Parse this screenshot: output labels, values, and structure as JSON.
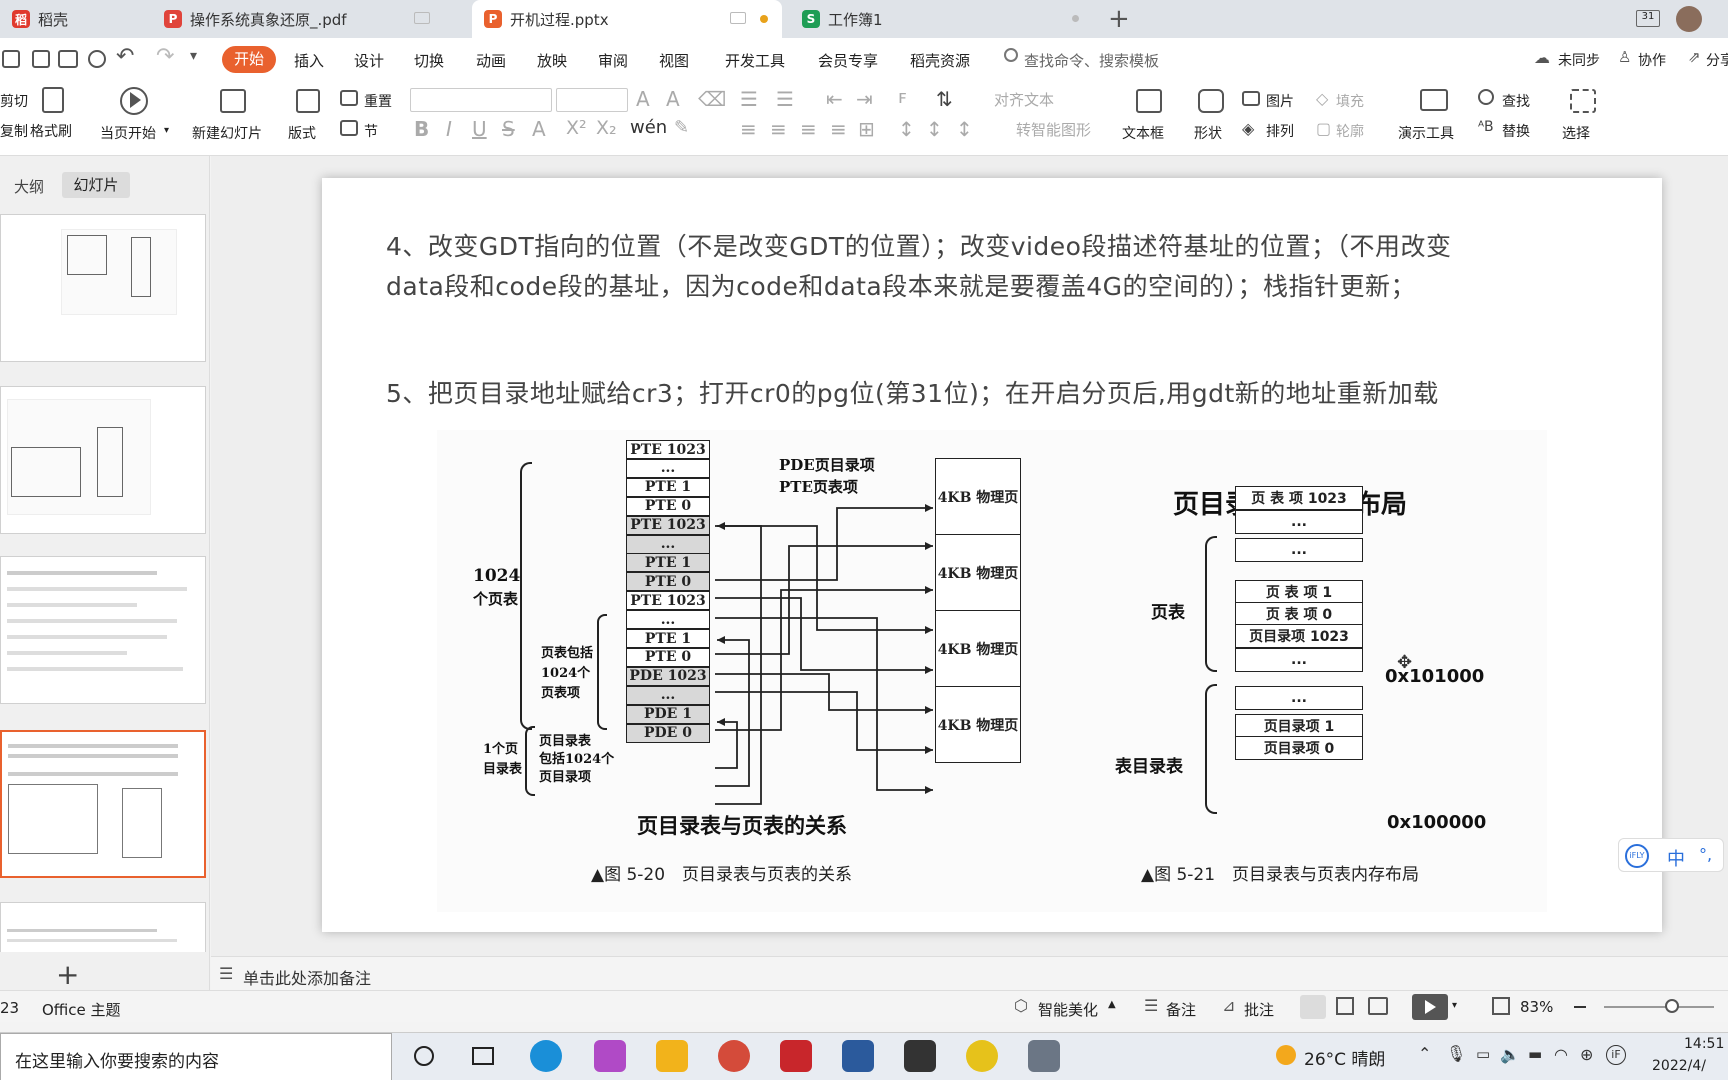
{
  "tabs": [
    {
      "label": "稻壳",
      "icon": "daoke-icon",
      "color": "#e03a2e"
    },
    {
      "label": "操作系统真象还原_.pdf",
      "icon": "pdf-icon",
      "color": "#e0443b"
    },
    {
      "label": "开机过程.pptx",
      "icon": "ppt-icon",
      "color": "#e9612e"
    },
    {
      "label": "工作簿1",
      "icon": "sheet-icon",
      "color": "#1f9d55"
    }
  ],
  "menu": {
    "items": [
      "开始",
      "插入",
      "设计",
      "切换",
      "动画",
      "放映",
      "审阅",
      "视图",
      "开发工具",
      "会员专享",
      "稻壳资源"
    ],
    "search": "查找命令、搜索模板",
    "sync": "未同步",
    "collab": "协作",
    "share": "分享"
  },
  "ribbon": {
    "cut": "剪切",
    "copy": "复制",
    "format_painter": "格式刷",
    "play_from_current": "当页开始",
    "new_slide": "新建幻灯片",
    "layout": "版式",
    "reset": "重置",
    "section": "节",
    "align_text": "对齐文本",
    "convert_smartart": "转智能图形",
    "textbox": "文本框",
    "shape": "形状",
    "picture": "图片",
    "fill": "填充",
    "arrange": "排列",
    "outline": "轮廓",
    "present_tool": "演示工具",
    "find": "查找",
    "replace": "替换",
    "select": "选择"
  },
  "panel": {
    "tab_outline": "大纲",
    "tab_slides": "幻灯片"
  },
  "slide": {
    "line1": "4、改变GDT指向的位置（不是改变GDT的位置）；改变video段描述符基址的位置；（不用改变",
    "line2": "data段和code段的基址，因为code和data段本来就是要覆盖4G的空间的）；栈指针更新；",
    "line3": "5、把页目录地址赋给cr3；打开cr0的pg位(第31位)；在开启分页后,用gdt新的地址重新加载"
  },
  "figure": {
    "left": {
      "cells": [
        "PTE 1023",
        "...",
        "PTE 1",
        "PTE 0",
        "PTE 1023",
        "...",
        "PTE 1",
        "PTE 0",
        "PTE 1023",
        "...",
        "PTE 1",
        "PTE 0",
        "PDE 1023",
        "...",
        "PDE 1",
        "PDE 0"
      ],
      "legend1": "PDE页目录项",
      "legend2": "PTE页表项",
      "pages": [
        "4KB 物理页",
        "4KB 物理页",
        "4KB 物理页",
        "4KB 物理页"
      ],
      "lbl_1024a": "1024",
      "lbl_1024b": "个页表",
      "lbl_pt1": "页表包括",
      "lbl_pt2": "1024个",
      "lbl_pt3": "页表项",
      "lbl_pd1": "1个页",
      "lbl_pd2": "目录表",
      "lbl_pdd1": "页目录表",
      "lbl_pdd2": "包括1024个",
      "lbl_pdd3": "页目录项",
      "title": "页目录表与页表的关系",
      "caption": "▲图 5-20　页目录表与页表的关系"
    },
    "right": {
      "title": "页目录表及页表布局",
      "cells": [
        "页 表 项 1023",
        "...",
        "...",
        "页 表 项 1",
        "页 表 项 0",
        "页目录项 1023",
        "...",
        "...",
        "页目录项 1",
        "页目录项 0"
      ],
      "lbl_pt": "页表",
      "lbl_pd": "表目录表",
      "addr1": "0x101000",
      "addr2": "0x100000",
      "caption": "▲图 5-21　页目录表与页表内存布局"
    }
  },
  "notes": "单击此处添加备注",
  "status": {
    "slide_num": "23",
    "theme": "Office 主题",
    "beautify": "智能美化",
    "notes": "备注",
    "comment": "批注",
    "zoom": "83%"
  },
  "taskbar": {
    "search": "在这里输入你要搜索的内容",
    "weather": "26°C 晴朗",
    "time": "14:51",
    "date": "2022/4/"
  },
  "ifly": {
    "lang": "中"
  }
}
